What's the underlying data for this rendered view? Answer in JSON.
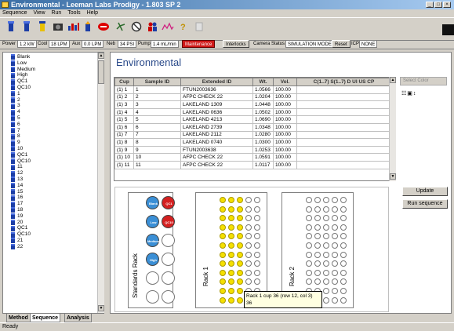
{
  "window": {
    "title": "Environmental - Leeman Labs Prodigy - 1.803  SP 2"
  },
  "menu": [
    "Sequence",
    "View",
    "Run",
    "Tools",
    "Help"
  ],
  "toolbar_icons": [
    "gauge-icon",
    "plasma-icon",
    "lamp-icon",
    "camera-icon",
    "chart-icon",
    "torch-icon",
    "stop-icon",
    "settings-icon",
    "no-entry-icon",
    "people-icon",
    "spectrum-icon",
    "question-icon",
    "blank-icon"
  ],
  "status": {
    "power_label": "Power",
    "power_value": "1.2 kW",
    "cool_label": "Cool",
    "cool_value": "18 LPM",
    "aux_label": "Aux",
    "aux_value": "0.0 LPM",
    "neb_label": "Neb",
    "neb_value": "34 PSI",
    "pump_label": "Pump",
    "pump_value": "1.4 mL/min",
    "maintenance": "Maintenance",
    "interlocks": "Interlocks",
    "camera_label": "Camera Status",
    "camera_value": "SIMULATION MODE",
    "reset": "Reset",
    "icp_label": "ICP",
    "icp_value": "NONE"
  },
  "tree": [
    "Blank",
    "Low",
    "Medium",
    "High",
    "QC1",
    "QC10",
    "1",
    "2",
    "3",
    "4",
    "5",
    "6",
    "7",
    "8",
    "9",
    "10",
    "QC1",
    "QC10",
    "11",
    "12",
    "13",
    "14",
    "15",
    "16",
    "17",
    "18",
    "19",
    "20",
    "QC1",
    "QC10",
    "21",
    "22"
  ],
  "left_tabs": [
    "Method",
    "Sequence",
    "Analysis"
  ],
  "main_title": "Environmental",
  "table": {
    "headers": [
      "Cup",
      "Sample ID",
      "Extended ID",
      "Wt.",
      "Vol.",
      "C(1..7) S(1..7) D UI US CP"
    ],
    "rows": [
      [
        "(1) 1",
        "1",
        "FTUN2003636",
        "1.0566",
        "100.00"
      ],
      [
        "(1) 2",
        "2",
        "AFPC CHECK 22",
        "1.0204",
        "100.00"
      ],
      [
        "(1) 3",
        "3",
        "LAKELAND 1309",
        "1.0448",
        "100.00"
      ],
      [
        "(1) 4",
        "4",
        "LAKELAND 0636",
        "1.0502",
        "100.00"
      ],
      [
        "(1) 5",
        "5",
        "LAKELAND 4213",
        "1.0690",
        "100.00"
      ],
      [
        "(1) 6",
        "6",
        "LAKELAND 2739",
        "1.0348",
        "100.00"
      ],
      [
        "(1) 7",
        "7",
        "LAKELAND 2112",
        "1.0280",
        "100.00"
      ],
      [
        "(1) 8",
        "8",
        "LAKELAND 0740",
        "1.0300",
        "100.00"
      ],
      [
        "(1) 9",
        "9",
        "FTUN2003638",
        "1.0253",
        "100.00"
      ],
      [
        "(1) 10",
        "10",
        "AFPC CHECK 22",
        "1.0591",
        "100.00"
      ],
      [
        "(1) 11",
        "11",
        "AFPC CHECK 22",
        "1.0117",
        "100.00"
      ]
    ]
  },
  "select_label": "Select Color",
  "buttons": {
    "update": "Update",
    "run_sequence": "Run sequence"
  },
  "racks": {
    "standards_label": "Standards Rack",
    "rack1_label": "Rack 1",
    "rack2_label": "Rack 2",
    "standards": [
      {
        "label": "Blank",
        "color": "#3a8fd6"
      },
      {
        "label": "QC1",
        "color": "#d42020"
      },
      {
        "label": "Low",
        "color": "#3a8fd6"
      },
      {
        "label": "QC10",
        "color": "#d42020"
      },
      {
        "label": "Medium",
        "color": "#3a8fd6"
      },
      {
        "label": "",
        "color": "#ffffff"
      },
      {
        "label": "High",
        "color": "#3a8fd6"
      },
      {
        "label": "",
        "color": "#ffffff"
      }
    ],
    "rack1_filled": 36,
    "rows": 12,
    "cols": 5
  },
  "tooltip": {
    "line1": "Rack 1 cup 36 (row 12, col 3)",
    "line2": "36"
  },
  "statusbar": "Ready",
  "colors": {
    "accent": "#2a4a8a",
    "selected_cup": "#f5e000",
    "standard_cup": "#3a8fd6",
    "qc_cup": "#d42020"
  }
}
